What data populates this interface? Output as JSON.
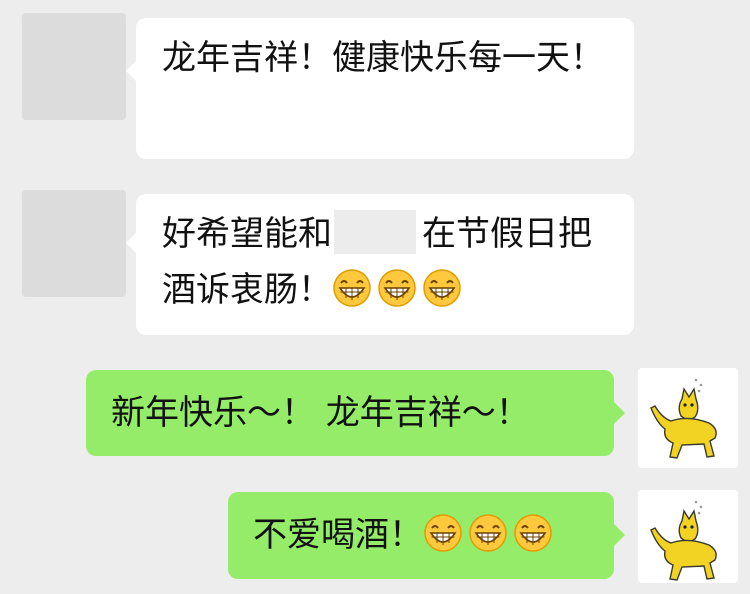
{
  "messages": [
    {
      "side": "left",
      "text": "龙年吉祥！健康快乐每一天！"
    },
    {
      "side": "left",
      "text_before": "好希望能和",
      "text_after": "在节假日把酒诉衷肠！",
      "emoji": [
        "grinning-face-emoji",
        "grinning-face-emoji",
        "grinning-face-emoji"
      ]
    },
    {
      "side": "right",
      "text": "新年快乐～！ 龙年吉祥～！"
    },
    {
      "side": "right",
      "text": "不爱喝酒！",
      "emoji": [
        "grinning-face-emoji",
        "grinning-face-emoji",
        "grinning-face-emoji"
      ]
    }
  ],
  "colors": {
    "background": "#ededed",
    "incoming_bubble": "#ffffff",
    "outgoing_bubble": "#95ec69",
    "avatar_placeholder": "#dcdcdc",
    "text": "#111111"
  }
}
